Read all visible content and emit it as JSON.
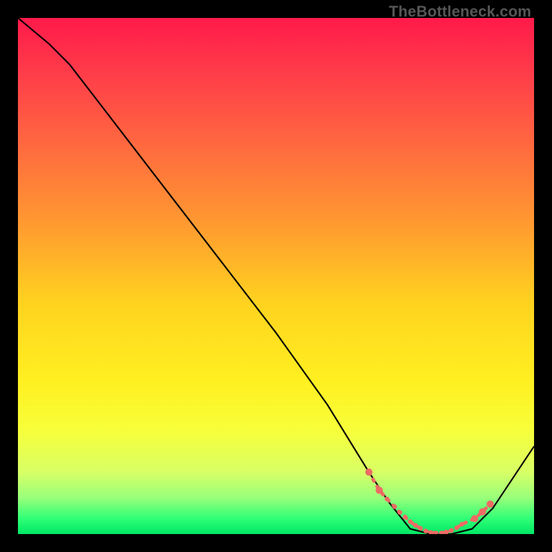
{
  "watermark": "TheBottleneck.com",
  "chart_data": {
    "type": "line",
    "title": "",
    "xlabel": "",
    "ylabel": "",
    "xlim": [
      0,
      100
    ],
    "ylim": [
      0,
      100
    ],
    "series": [
      {
        "name": "curve",
        "x": [
          0,
          6,
          10,
          20,
          30,
          40,
          50,
          60,
          68,
          72,
          76,
          80,
          84,
          88,
          92,
          100
        ],
        "values": [
          100,
          95,
          91,
          78,
          65,
          52,
          39,
          25,
          12,
          6,
          1,
          0,
          0,
          1,
          5,
          17
        ]
      }
    ],
    "highlight_points": {
      "comment": "coral dots along the dashed trough section",
      "x": [
        68.0,
        70.0,
        71.5,
        73.0,
        74.0,
        75.0,
        76.0,
        77.0,
        78.0,
        79.0,
        80.0,
        81.0,
        82.0,
        83.0,
        84.0,
        85.0,
        86.0,
        88.5,
        90.0,
        91.5
      ],
      "values": [
        12.0,
        8.5,
        6.8,
        5.3,
        4.2,
        3.3,
        2.4,
        1.7,
        1.1,
        0.6,
        0.3,
        0.2,
        0.2,
        0.4,
        0.7,
        1.2,
        1.9,
        3.0,
        4.3,
        5.8
      ]
    },
    "gradient_stops": [
      {
        "offset": 0.0,
        "color": "#ff1a4a"
      },
      {
        "offset": 0.1,
        "color": "#ff3a4a"
      },
      {
        "offset": 0.25,
        "color": "#ff6a3f"
      },
      {
        "offset": 0.4,
        "color": "#ff9a30"
      },
      {
        "offset": 0.55,
        "color": "#ffd21f"
      },
      {
        "offset": 0.7,
        "color": "#ffef20"
      },
      {
        "offset": 0.8,
        "color": "#f7ff3a"
      },
      {
        "offset": 0.88,
        "color": "#d8ff66"
      },
      {
        "offset": 0.93,
        "color": "#98ff7a"
      },
      {
        "offset": 0.97,
        "color": "#2fff76"
      },
      {
        "offset": 1.0,
        "color": "#00e765"
      }
    ],
    "colors": {
      "curve": "#000000",
      "dots": "#ee6a64",
      "dash": "#ee6a64"
    }
  }
}
